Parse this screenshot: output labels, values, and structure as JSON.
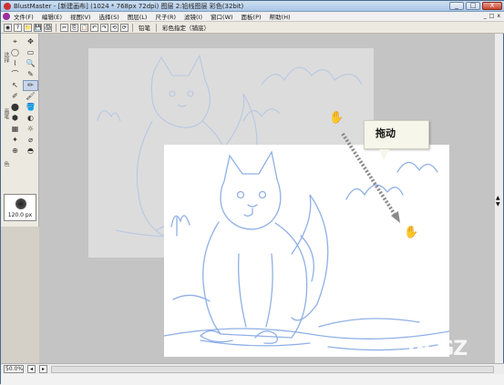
{
  "window": {
    "title": "BlustMaster - [新建画布] (1024 * 768px 72dpi)  图层 2:铅线图层 彩色(32bit)"
  },
  "window_buttons": {
    "minimize": "_",
    "maximize": "□",
    "close": "X"
  },
  "menu": [
    "文件(F)",
    "编辑(E)",
    "视图(V)",
    "选择(S)",
    "图层(L)",
    "尺子(R)",
    "滤镜(I)",
    "窗口(W)",
    "面板(P)",
    "帮助(H)"
  ],
  "mdi_controls": [
    "_",
    "□",
    "x"
  ],
  "toolbar": {
    "pen_label": "铅笔",
    "color_setting_label": "彩色指定（铺底）",
    "buttons": [
      "◉",
      "?",
      "📁",
      "💾",
      "🖨",
      "✂",
      "⎘",
      "📋",
      "↶",
      "↷",
      "⟲",
      "⟳"
    ]
  },
  "toolbox": {
    "side_labels": [
      "选择",
      "画笔",
      "色"
    ],
    "tools": [
      "⌖",
      "✥",
      "◯",
      "▭",
      "⌇",
      "🔍",
      "⌒",
      "✎",
      "↖",
      "✏",
      "✐",
      "🖌",
      "⬤",
      "🪣",
      "⬢",
      "◐",
      "▦",
      "☼",
      "✦",
      "⌀",
      "⊕",
      "◓"
    ],
    "brush_size": "120.0 px"
  },
  "statusbar": {
    "zoom": "50.0%"
  },
  "callout": {
    "text": "拖动"
  },
  "cursors": {
    "start_icon": "grab-hand-icon",
    "end_icon": "grab-hand-icon"
  },
  "watermark": {
    "text": "GCGZ"
  },
  "colors": {
    "sketch_line": "#8fb0e6",
    "canvas_bg": "#ffffff",
    "canvas_back_bg": "#dcdcdc",
    "workspace_bg": "#c4c4c4",
    "drag_arrow": "#8a8a8a"
  }
}
